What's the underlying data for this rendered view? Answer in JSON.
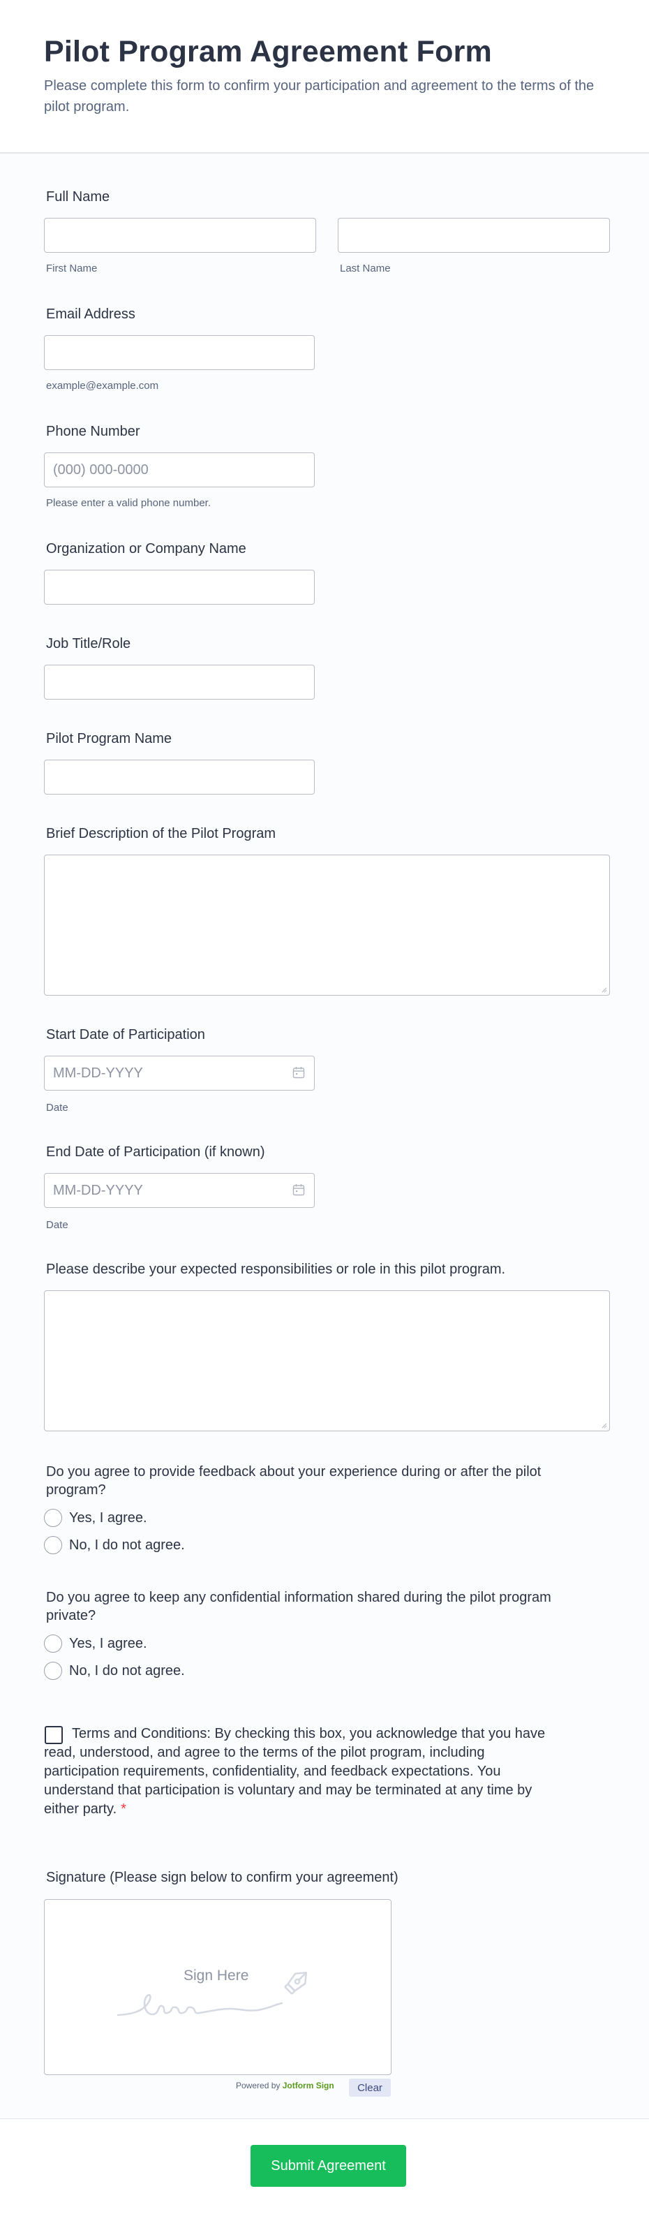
{
  "header": {
    "title": "Pilot Program Agreement Form",
    "subtitle": "Please complete this form to confirm your participation and agreement to the terms of the pilot program."
  },
  "fields": {
    "full_name": {
      "label": "Full Name",
      "first_sublabel": "First Name",
      "last_sublabel": "Last Name",
      "first_value": "",
      "last_value": ""
    },
    "email": {
      "label": "Email Address",
      "sublabel": "example@example.com",
      "value": ""
    },
    "phone": {
      "label": "Phone Number",
      "placeholder": "(000) 000-0000",
      "sublabel": "Please enter a valid phone number.",
      "value": ""
    },
    "organization": {
      "label": "Organization or Company Name",
      "value": ""
    },
    "job_title": {
      "label": "Job Title/Role",
      "value": ""
    },
    "pilot_name": {
      "label": "Pilot Program Name",
      "value": ""
    },
    "description": {
      "label": "Brief Description of the Pilot Program",
      "value": ""
    },
    "start_date": {
      "label": "Start Date of Participation",
      "placeholder": "MM-DD-YYYY",
      "sublabel": "Date",
      "icon": "calendar-icon"
    },
    "end_date": {
      "label": "End Date of Participation (if known)",
      "placeholder": "MM-DD-YYYY",
      "sublabel": "Date",
      "icon": "calendar-icon"
    },
    "responsibilities": {
      "label": "Please describe your expected responsibilities or role in this pilot program.",
      "value": ""
    }
  },
  "questions": {
    "feedback": {
      "label": "Do you agree to provide feedback about your experience during or after the pilot program?",
      "options": [
        "Yes, I agree.",
        "No, I do not agree."
      ]
    },
    "confidential": {
      "label": "Do you agree to keep any confidential information shared during the pilot program private?",
      "options": [
        "Yes, I agree.",
        "No, I do not agree."
      ]
    }
  },
  "terms": {
    "text": "Terms and Conditions: By checking this box, you acknowledge that you have read, understood, and agree to the terms of the pilot program, including participation requirements, confidentiality, and feedback expectations. You understand that participation is voluntary and may be terminated at any time by either party.",
    "required_mark": "*",
    "checked": false
  },
  "signature": {
    "label": "Signature (Please sign below to confirm your agreement)",
    "placeholder": "Sign Here",
    "powered_prefix": "Powered by",
    "powered_brand": "Jotform Sign",
    "clear_label": "Clear",
    "icon": "pen-nib-icon"
  },
  "submit_label": "Submit Agreement",
  "colors": {
    "submit": "#18bd5b",
    "required": "#f23a3c",
    "brand": "#5b9a1f",
    "text": "#2c3345"
  }
}
